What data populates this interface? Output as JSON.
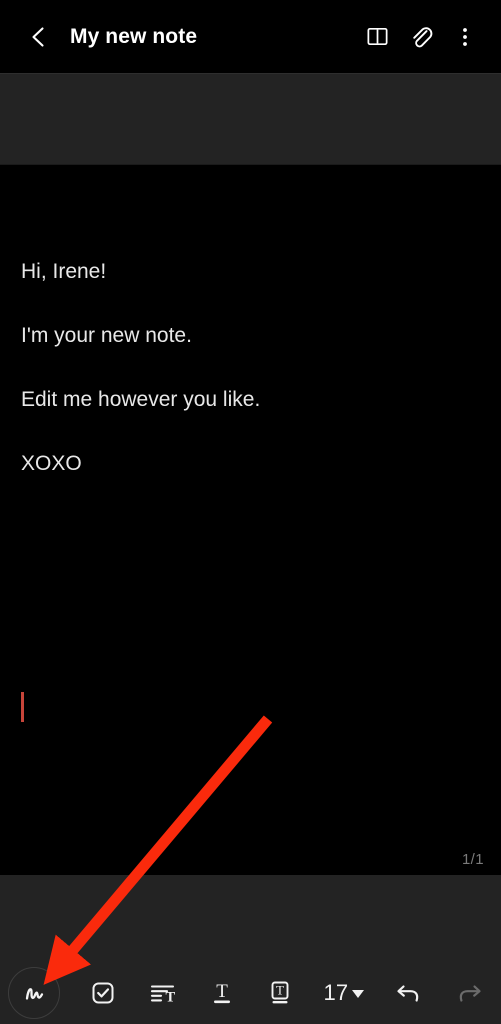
{
  "header": {
    "back_icon": "chevron-left-icon",
    "title": "My new note",
    "actions": [
      {
        "icon": "book-open-icon",
        "label": "Reading mode"
      },
      {
        "icon": "paperclip-icon",
        "label": "Attach"
      },
      {
        "icon": "more-vertical-icon",
        "label": "More options"
      }
    ]
  },
  "note": {
    "lines": [
      "Hi, Irene!",
      "I'm your new note.",
      "Edit me however you like.",
      "XOXO"
    ],
    "page_indicator": "1/1",
    "caret_color": "#c7453a"
  },
  "toolbar": {
    "pen": {
      "icon": "handwriting-pen-icon",
      "label": "Handwriting"
    },
    "items": [
      {
        "icon": "checkbox-icon",
        "label": "Checklist"
      },
      {
        "icon": "paragraph-format-icon",
        "label": "Paragraph format"
      },
      {
        "icon": "text-underline-icon",
        "label": "Text style"
      },
      {
        "icon": "text-box-icon",
        "label": "Text box"
      }
    ],
    "font_size": "17",
    "font_size_caret": "chevron-down-icon",
    "undo": {
      "icon": "undo-icon",
      "label": "Undo",
      "enabled": true
    },
    "redo": {
      "icon": "redo-icon",
      "label": "Redo",
      "enabled": false
    }
  },
  "annotation": {
    "arrow_color": "#fa2a0c",
    "target": "handwriting-pen-button"
  },
  "colors": {
    "background": "#000000",
    "band": "#232323",
    "toolbar": "#232323",
    "text": "#e8e8e8",
    "muted": "#7a7a7a",
    "disabled": "#6b6b6b"
  }
}
